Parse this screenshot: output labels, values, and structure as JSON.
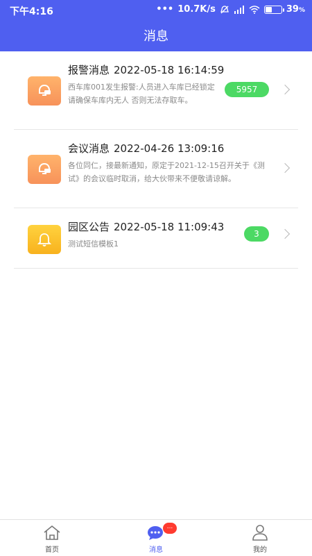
{
  "status_bar": {
    "time": "下午4:16",
    "network_speed": "10.7K/s",
    "battery": "39"
  },
  "header": {
    "title": "消息"
  },
  "messages": [
    {
      "title": "报警消息",
      "time": "2022-05-18 16:14:59",
      "body": "西车库001发生报警:人员进入车库已经锁定 请确保车库内无人 否则无法存取车。",
      "badge": "5957",
      "icon": "message-bell-icon"
    },
    {
      "title": "会议消息",
      "time": "2022-04-26 13:09:16",
      "body": "各位同仁，接最新通知，原定于2021-12-15召开关于《测试》的会议临时取消，给大伙带来不便敬请谅解。",
      "badge": "",
      "icon": "message-bell-icon"
    },
    {
      "title": "园区公告",
      "time": "2022-05-18 11:09:43",
      "body": "测试短信模板1",
      "badge": "3",
      "icon": "bell-icon"
    }
  ],
  "tabbar": {
    "tabs": [
      {
        "label": "首页",
        "icon": "home-icon"
      },
      {
        "label": "消息",
        "icon": "chat-icon",
        "badge": "..."
      },
      {
        "label": "我的",
        "icon": "user-icon"
      }
    ],
    "active": "消息"
  },
  "colors": {
    "primary": "#4f5ff0",
    "badge_green": "#4cd964",
    "badge_red": "#ff3b30"
  }
}
